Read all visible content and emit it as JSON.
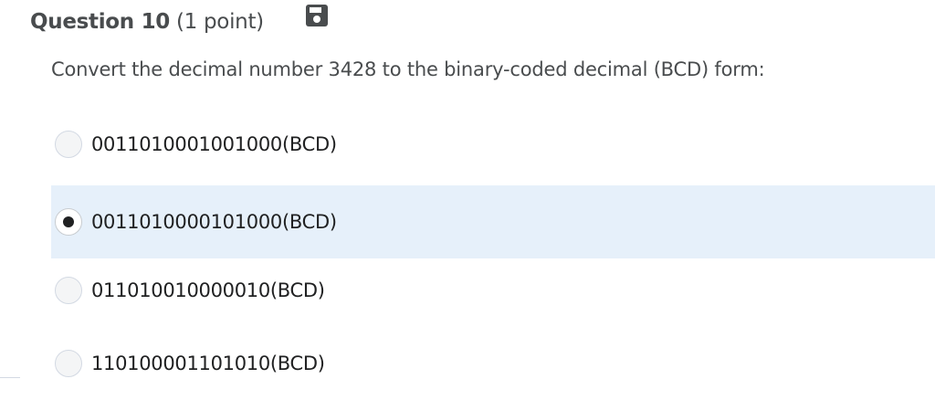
{
  "question": {
    "title": "Question 10",
    "points": "(1 point)",
    "save_icon": "floppy-disk-save-icon",
    "prompt": "Convert the decimal number 3428 to the binary-coded decimal (BCD) form:"
  },
  "options": [
    {
      "label": "0011010001001000(BCD)",
      "selected": false
    },
    {
      "label": "0011010000101000(BCD)",
      "selected": true
    },
    {
      "label": "011010010000010(BCD)",
      "selected": false
    },
    {
      "label": "110100001101010(BCD)",
      "selected": false
    }
  ],
  "colors": {
    "selected_background": "#e6f0fa",
    "text": "#494c4e",
    "option_text": "#202122"
  }
}
